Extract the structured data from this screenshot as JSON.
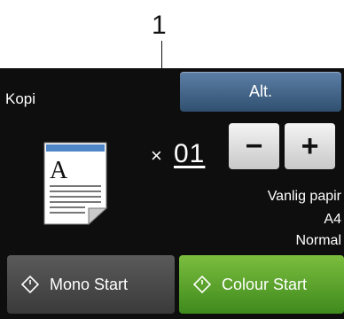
{
  "callout": {
    "number": "1"
  },
  "screen": {
    "title": "Kopi",
    "options_button": "Alt.",
    "copies": {
      "prefix": "×",
      "value": "01"
    },
    "stepper": {
      "minus": "−",
      "plus": "+"
    },
    "settings": {
      "paper_type": "Vanlig papir",
      "paper_size": "A4",
      "quality": "Normal"
    },
    "mono_start": "Mono Start",
    "colour_start": "Colour Start"
  },
  "colors": {
    "screen_bg": "#0e0e0e",
    "alt_button": "#4a6d92",
    "colour_start": "#5aa62c",
    "mono_start": "#4a4a4a"
  }
}
